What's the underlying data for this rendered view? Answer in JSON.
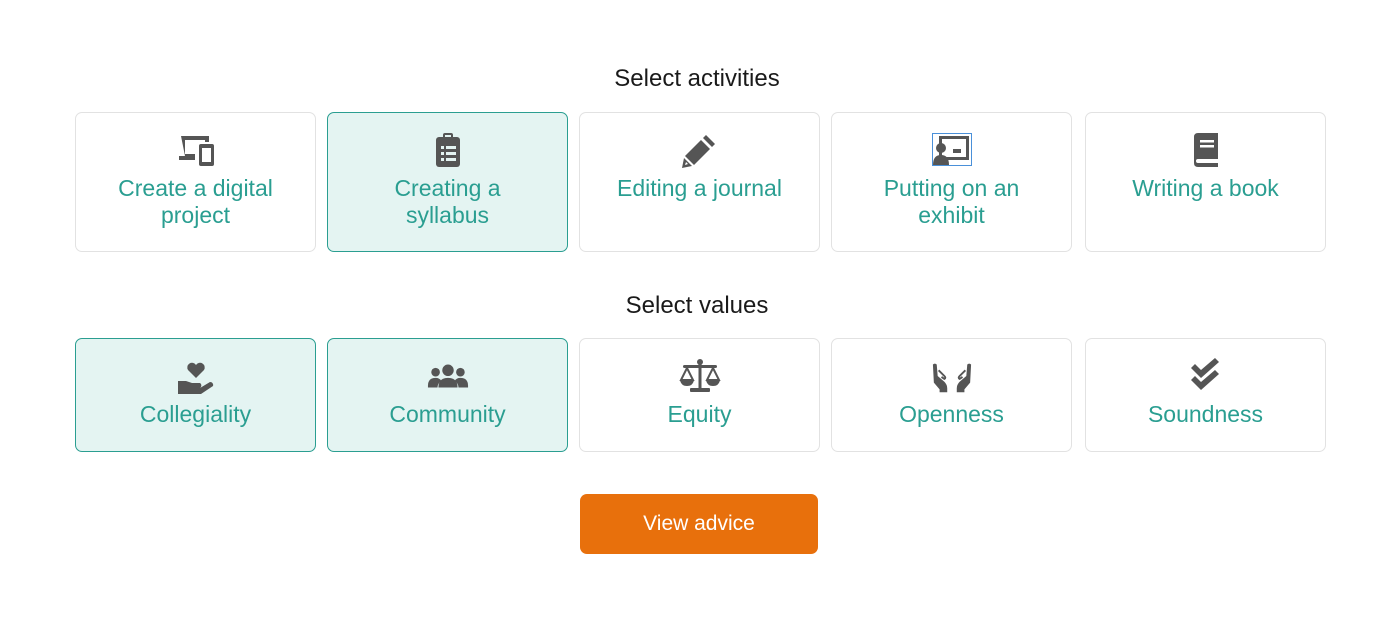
{
  "activities": {
    "title": "Select activities",
    "items": [
      {
        "label": "Create a digital project",
        "icon": "devices-icon",
        "selected": false
      },
      {
        "label": "Creating a syllabus",
        "icon": "clipboard-list-icon",
        "selected": true
      },
      {
        "label": "Editing a journal",
        "icon": "pencil-icon",
        "selected": false
      },
      {
        "label": "Putting on an exhibit",
        "icon": "presentation-icon",
        "selected": false
      },
      {
        "label": "Writing a book",
        "icon": "book-icon",
        "selected": false
      }
    ]
  },
  "values": {
    "title": "Select values",
    "items": [
      {
        "label": "Collegiality",
        "icon": "hand-holding-heart-icon",
        "selected": true
      },
      {
        "label": "Community",
        "icon": "users-icon",
        "selected": true
      },
      {
        "label": "Equity",
        "icon": "balance-scale-icon",
        "selected": false
      },
      {
        "label": "Openness",
        "icon": "open-hands-icon",
        "selected": false
      },
      {
        "label": "Soundness",
        "icon": "double-check-icon",
        "selected": false
      }
    ]
  },
  "actions": {
    "view_advice_label": "View advice"
  },
  "colors": {
    "accent": "#2a9e91",
    "selected_bg": "#e4f4f2",
    "button": "#e8700c",
    "icon": "#555555"
  }
}
